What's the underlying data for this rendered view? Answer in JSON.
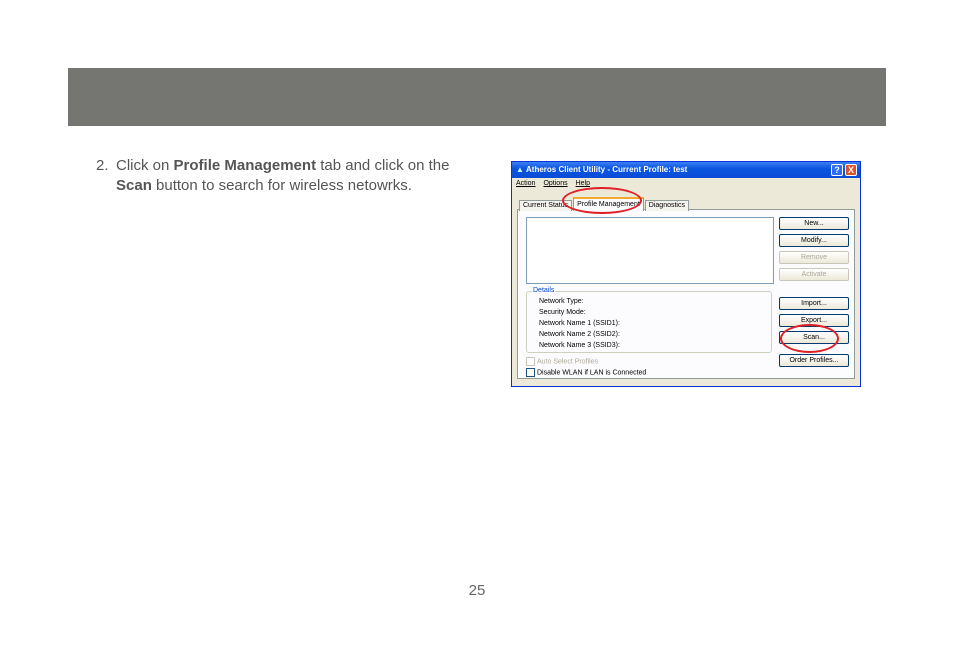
{
  "step": {
    "number": "2.",
    "pre": "Click on ",
    "bold1": "Profile Management",
    "mid": " tab and click on the ",
    "bold2": "Scan",
    "post": " button to search for wireless netowrks."
  },
  "page_number": "25",
  "window": {
    "title": "Atheros Client Utility - Current Profile: test",
    "help_btn": "?",
    "close_btn": "X",
    "menu": [
      "Action",
      "Options",
      "Help"
    ],
    "tabs": [
      "Current Status",
      "Profile Management",
      "Diagnostics"
    ],
    "active_tab": "Profile Management",
    "buttons": {
      "new": "New...",
      "modify": "Modify...",
      "remove": "Remove",
      "activate": "Activate",
      "import": "Import...",
      "export": "Export...",
      "scan": "Scan...",
      "order": "Order Profiles..."
    },
    "details": {
      "legend": "Details",
      "rows": [
        "Network Type:",
        "Security Mode:",
        "Network Name 1 (SSID1):",
        "Network Name 2 (SSID2):",
        "Network Name 3 (SSID3):"
      ]
    },
    "checkbox_auto": "Auto Select Profiles",
    "checkbox_disable": "Disable WLAN if LAN is Connected"
  },
  "colors": {
    "header_band": "#757672",
    "highlight_circle": "#e01f26",
    "title_bar": "#0b55e0"
  }
}
